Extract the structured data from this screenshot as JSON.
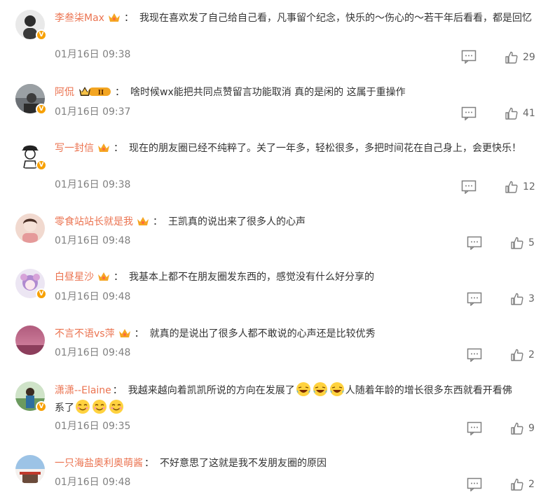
{
  "comments": [
    {
      "username": "李叁柒Max",
      "badge": "crown",
      "text": "我现在喜欢发了自己给自己看，凡事留个纪念，快乐的～伤心的～若干年后看看，都是回忆",
      "time": "01月16日 09:38",
      "likes": "29"
    },
    {
      "username": "阿侃",
      "badge": "vip",
      "vip_level": "II",
      "text": "啥时候wx能把共同点赞留言功能取消 真的是闲的 这属于重操作",
      "time": "01月16日 09:37",
      "likes": "41"
    },
    {
      "username": "写一封信",
      "badge": "crown",
      "text": "现在的朋友圈已经不纯粹了。关了一年多，轻松很多，多把时间花在自己身上，会更快乐！",
      "time": "01月16日 09:38",
      "likes": "12"
    },
    {
      "username": "零食站站长就是我",
      "badge": "crown",
      "text": "王凯真的说出来了很多人的心声",
      "time": "01月16日 09:48",
      "likes": "5"
    },
    {
      "username": "白昼星沙",
      "badge": "crown",
      "text": "我基本上都不在朋友圈发东西的，感觉没有什么好分享的",
      "time": "01月16日 09:48",
      "likes": "3"
    },
    {
      "username": "不言不语vs萍",
      "badge": "crown",
      "text": "就真的是说出了很多人都不敢说的心声还是比较优秀",
      "time": "01月16日 09:48",
      "likes": "2"
    },
    {
      "username": "潇潇--Elaine",
      "badge": "none",
      "text_part1": "我越来越向着凯凯所说的方向在发展了",
      "text_part2": "人随着年龄的增长很多东西就看开看佛",
      "text_line2": "系了",
      "time": "01月16日 09:35",
      "likes": "9"
    },
    {
      "username": "一只海盐奥利奥萌酱",
      "badge": "none",
      "text": "不好意思了这就是我不发朋友圈的原因",
      "time": "01月16日 09:48",
      "likes": "2"
    }
  ],
  "colors": {
    "username": "#eb7350",
    "meta": "#808080",
    "badge_gold": "#f7a000"
  },
  "icons": {
    "reply": "comment-icon",
    "like": "thumbs-up-icon",
    "verified": "v-badge",
    "member": "crown-icon"
  }
}
